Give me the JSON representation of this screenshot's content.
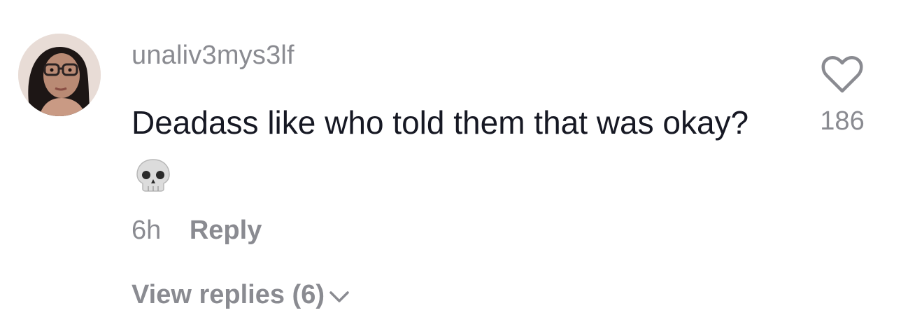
{
  "comment": {
    "username": "unaliv3mys3lf",
    "text": "Deadass like who told them that was okay?",
    "emoji": "skull-emoji",
    "time": "6h",
    "reply_label": "Reply",
    "view_replies_label": "View replies (6)",
    "like_count": "186"
  },
  "icons": {
    "like": "heart-outline-icon",
    "expand": "chevron-down-icon"
  },
  "colors": {
    "primary_text": "#161823",
    "secondary_text": "#8a8b91",
    "background": "#ffffff"
  }
}
